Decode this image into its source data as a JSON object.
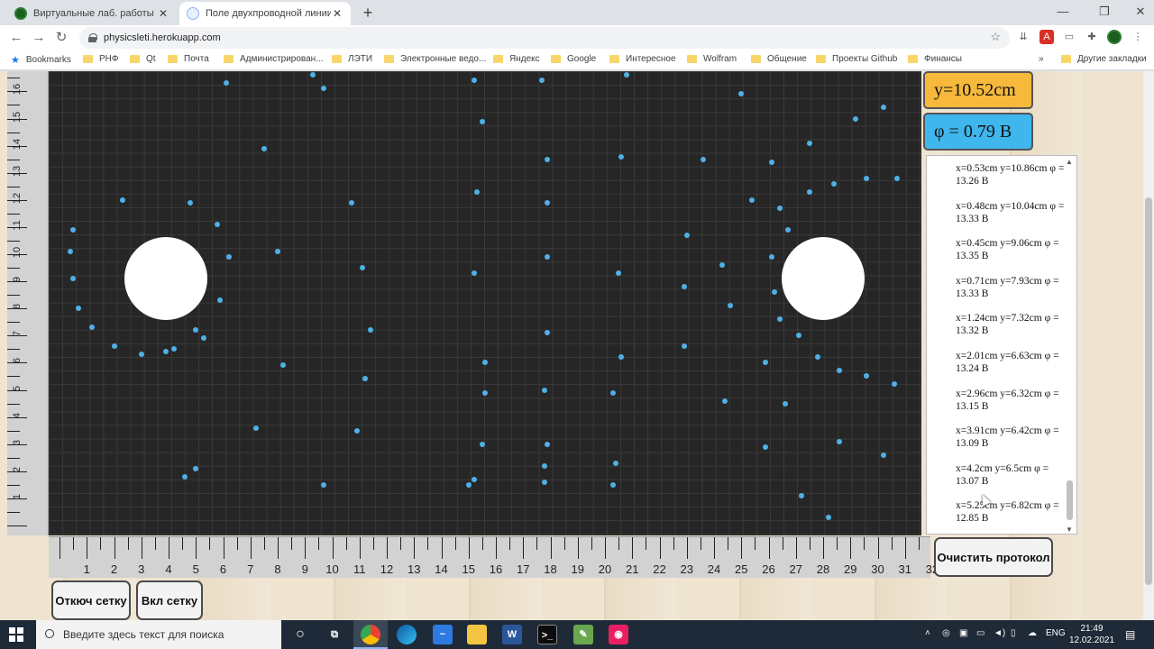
{
  "browser": {
    "tabs": [
      {
        "title": "Виртуальные лаб. работы - phy",
        "active": false
      },
      {
        "title": "Поле двухпроводной линии",
        "active": true
      }
    ],
    "url": "physicsleti.herokuapp.com",
    "bookmarks_label": "Bookmarks",
    "bookmarks": [
      "РНФ",
      "Qt",
      "Почта",
      "Администрирован...",
      "ЛЭТИ",
      "Электронные ведо...",
      "Яндекс",
      "Google",
      "Интересное",
      "Wolfram",
      "Общение",
      "Проекты Github",
      "Финансы"
    ],
    "more_bookmarks_symbol": "»",
    "other_bookmarks": "Другие закладки"
  },
  "app": {
    "y_readout": "y=10.52cm",
    "phi_readout": "φ = 0.79 В",
    "y_readout_color": "#f6b93b",
    "phi_readout_color": "#3fb6ec",
    "point_color": "#4fb0e8",
    "board_color": "#262626",
    "left_ruler_labels": [
      "16",
      "15",
      "14",
      "13",
      "12",
      "11",
      "10",
      "9",
      "8",
      "7",
      "6",
      "5",
      "4",
      "3",
      "2",
      "1"
    ],
    "bottom_ruler_labels": [
      "1",
      "2",
      "3",
      "4",
      "5",
      "6",
      "7",
      "8",
      "9",
      "10",
      "11",
      "12",
      "13",
      "14",
      "15",
      "16",
      "17",
      "18",
      "19",
      "20",
      "21",
      "22",
      "23",
      "24",
      "25",
      "26",
      "27",
      "28",
      "29",
      "30",
      "31",
      "32"
    ],
    "protocol": [
      "x=0.53cm y=10.86cm φ = 13.26 В",
      "x=0.48cm y=10.04cm φ = 13.33 В",
      "x=0.45cm y=9.06cm φ = 13.35 В",
      "x=0.71cm y=7.93cm φ = 13.33 В",
      "x=1.24cm y=7.32cm φ = 13.32 В",
      "x=2.01cm y=6.63cm φ = 13.24 В",
      "x=2.96cm y=6.32cm φ = 13.15 В",
      "x=3.91cm y=6.42cm φ = 13.09 В",
      "x=4.2cm y=6.5cm φ = 13.07 В",
      "x=5.25cm y=6.82cm φ = 12.85 В"
    ],
    "clear_button": "Очистить протокол",
    "grid_off_button": "Откюч сетку",
    "grid_on_button": "Вкл сетку",
    "conductors": [
      {
        "x_cm": 3.9,
        "y_cm": 9.1
      },
      {
        "x_cm": 28.0,
        "y_cm": 9.1
      }
    ],
    "measured_points_cm": [
      [
        4.8,
        16.9
      ],
      [
        6.1,
        16.3
      ],
      [
        9.3,
        16.6
      ],
      [
        9.7,
        16.1
      ],
      [
        15.2,
        16.4
      ],
      [
        17.6,
        16.9
      ],
      [
        17.7,
        16.4
      ],
      [
        20.8,
        16.6
      ],
      [
        15.5,
        14.9
      ],
      [
        25.0,
        15.9
      ],
      [
        29.2,
        15.0
      ],
      [
        30.2,
        15.4
      ],
      [
        7.5,
        13.9
      ],
      [
        17.9,
        13.5
      ],
      [
        20.6,
        13.6
      ],
      [
        23.6,
        13.5
      ],
      [
        26.1,
        13.4
      ],
      [
        27.5,
        14.1
      ],
      [
        15.3,
        12.3
      ],
      [
        28.4,
        12.6
      ],
      [
        29.6,
        12.8
      ],
      [
        30.7,
        12.8
      ],
      [
        27.5,
        12.3
      ],
      [
        2.3,
        12.0
      ],
      [
        4.8,
        11.9
      ],
      [
        10.7,
        11.9
      ],
      [
        17.9,
        11.9
      ],
      [
        25.4,
        12.0
      ],
      [
        26.4,
        11.7
      ],
      [
        0.5,
        10.9
      ],
      [
        5.8,
        11.1
      ],
      [
        0.4,
        10.1
      ],
      [
        6.2,
        9.9
      ],
      [
        8.0,
        10.1
      ],
      [
        23.0,
        10.7
      ],
      [
        26.7,
        10.9
      ],
      [
        0.5,
        9.1
      ],
      [
        11.1,
        9.5
      ],
      [
        15.2,
        9.3
      ],
      [
        17.9,
        9.9
      ],
      [
        20.5,
        9.3
      ],
      [
        24.3,
        9.6
      ],
      [
        26.1,
        9.9
      ],
      [
        0.7,
        8.0
      ],
      [
        5.9,
        8.3
      ],
      [
        22.9,
        8.8
      ],
      [
        24.6,
        8.1
      ],
      [
        26.2,
        8.6
      ],
      [
        1.2,
        7.3
      ],
      [
        5.0,
        7.2
      ],
      [
        5.3,
        6.9
      ],
      [
        11.4,
        7.2
      ],
      [
        17.9,
        7.1
      ],
      [
        26.4,
        7.6
      ],
      [
        27.1,
        7.0
      ],
      [
        2.0,
        6.6
      ],
      [
        3.0,
        6.3
      ],
      [
        3.9,
        6.4
      ],
      [
        4.2,
        6.5
      ],
      [
        8.2,
        5.9
      ],
      [
        15.6,
        6.0
      ],
      [
        20.6,
        6.2
      ],
      [
        22.9,
        6.6
      ],
      [
        25.9,
        6.0
      ],
      [
        27.8,
        6.2
      ],
      [
        11.2,
        5.4
      ],
      [
        15.6,
        4.9
      ],
      [
        17.8,
        5.0
      ],
      [
        20.3,
        4.9
      ],
      [
        24.4,
        4.6
      ],
      [
        26.6,
        4.5
      ],
      [
        28.6,
        5.7
      ],
      [
        29.6,
        5.5
      ],
      [
        30.6,
        5.2
      ],
      [
        7.2,
        3.6
      ],
      [
        10.9,
        3.5
      ],
      [
        15.5,
        3.0
      ],
      [
        17.9,
        3.0
      ],
      [
        25.9,
        2.9
      ],
      [
        28.6,
        3.1
      ],
      [
        30.2,
        2.6
      ],
      [
        4.6,
        1.8
      ],
      [
        5.0,
        2.1
      ],
      [
        9.7,
        1.5
      ],
      [
        15.0,
        1.5
      ],
      [
        15.2,
        1.7
      ],
      [
        17.8,
        2.2
      ],
      [
        17.8,
        1.6
      ],
      [
        20.3,
        1.5
      ],
      [
        20.4,
        2.3
      ],
      [
        27.2,
        1.1
      ],
      [
        28.2,
        0.3
      ]
    ]
  },
  "taskbar": {
    "search_placeholder": "Введите здесь текст для поиска",
    "language": "ENG",
    "time": "21:49",
    "date": "12.02.2021"
  }
}
